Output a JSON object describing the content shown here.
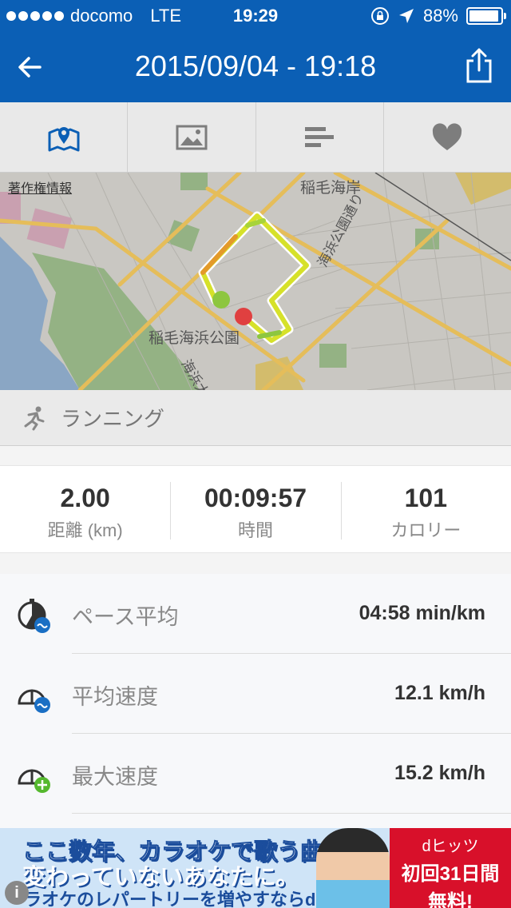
{
  "status": {
    "carrier": "docomo",
    "network": "LTE",
    "time": "19:29",
    "battery": "88%",
    "battery_level": 0.88
  },
  "nav": {
    "title": "2015/09/04 - 19:18",
    "back_icon": "back-arrow-icon",
    "share_icon": "share-icon"
  },
  "tabs": [
    {
      "name": "map",
      "icon": "map-pin-icon",
      "active": true
    },
    {
      "name": "photo",
      "icon": "image-icon",
      "active": false
    },
    {
      "name": "splits",
      "icon": "bars-icon",
      "active": false
    },
    {
      "name": "favorite",
      "icon": "heart-icon",
      "active": false
    }
  ],
  "map": {
    "copyright": "著作権情報",
    "labels": {
      "area1": "稲毛海岸",
      "road1": "海浜公園通り",
      "park": "稲毛海浜公園",
      "road2": "海浜大"
    }
  },
  "activity": {
    "type": "ランニング",
    "icon": "runner-icon"
  },
  "stats": [
    {
      "value": "2.00",
      "label": "距離 (km)"
    },
    {
      "value": "00:09:57",
      "label": "時間"
    },
    {
      "value": "101",
      "label": "カロリー"
    }
  ],
  "details": [
    {
      "label": "ペース平均",
      "value": "04:58 min/km",
      "icon": "pace-average-icon"
    },
    {
      "label": "平均速度",
      "value": "12.1 km/h",
      "icon": "average-speed-icon"
    },
    {
      "label": "最大速度",
      "value": "15.2 km/h",
      "icon": "max-speed-icon"
    }
  ],
  "ad": {
    "line1": "ここ数年、カラオケで歌う曲が",
    "line2": "変わっていないあなたに。",
    "line3": "ラオケのレパートリーを増やすならdヒッツ!",
    "badge_brand": "dヒッツ",
    "badge_offer1": "初回31日間",
    "badge_offer2": "無料!",
    "info": "i"
  },
  "colors": {
    "brand": "#0b5fb5",
    "tab_active": "#0b5fb5",
    "tab_inactive": "#7d7d7d",
    "route_start": "#8dc63f",
    "route_end": "#e04040"
  }
}
